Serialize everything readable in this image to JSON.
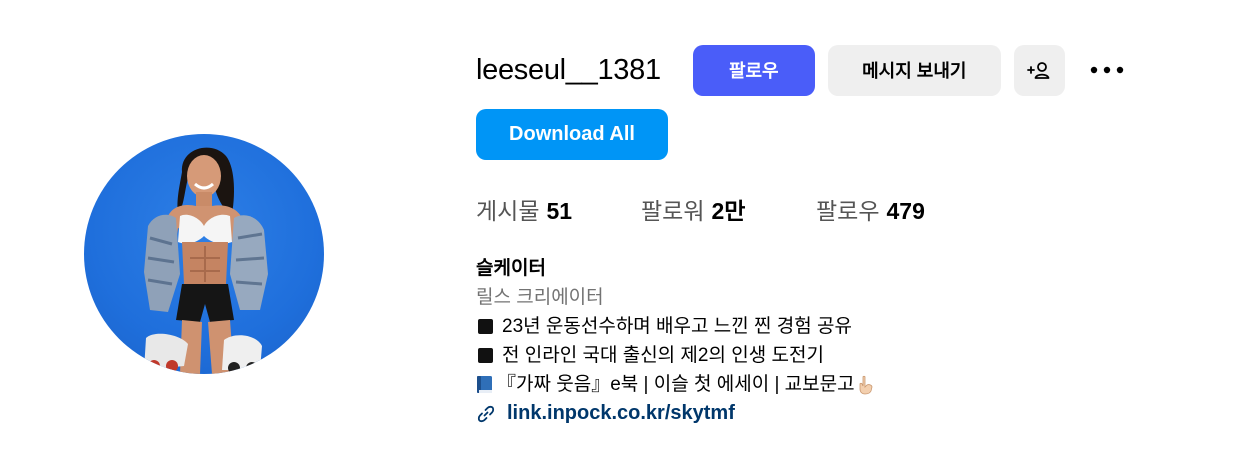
{
  "profile": {
    "username": "leeseul__1381",
    "follow_label": "팔로우",
    "message_label": "메시지 보내기",
    "suggest_icon": "add-person-icon",
    "more_icon": "more-options-icon",
    "download_label": "Download All"
  },
  "stats": {
    "posts_label": "게시물",
    "posts_value": "51",
    "followers_label": "팔로워",
    "followers_value": "2만",
    "following_label": "팔로우",
    "following_value": "479"
  },
  "bio": {
    "name": "슬케이터",
    "category": "릴스 크리에이터",
    "line1": "23년 운동선수하며 배우고 느낀 찐 경험 공유",
    "line2": "전 인라인 국대 출신의 제2의 인생 도전기",
    "line3": "『가짜 웃음』e북 | 이슬 첫 에세이 | 교보문고",
    "link": "link.inpock.co.kr/skytmf"
  },
  "colors": {
    "follow_button": "#4a5df9",
    "download_button": "#0095f6",
    "secondary_button": "#efefef",
    "avatar_background": "#1f6fdc",
    "link": "#00376b"
  }
}
